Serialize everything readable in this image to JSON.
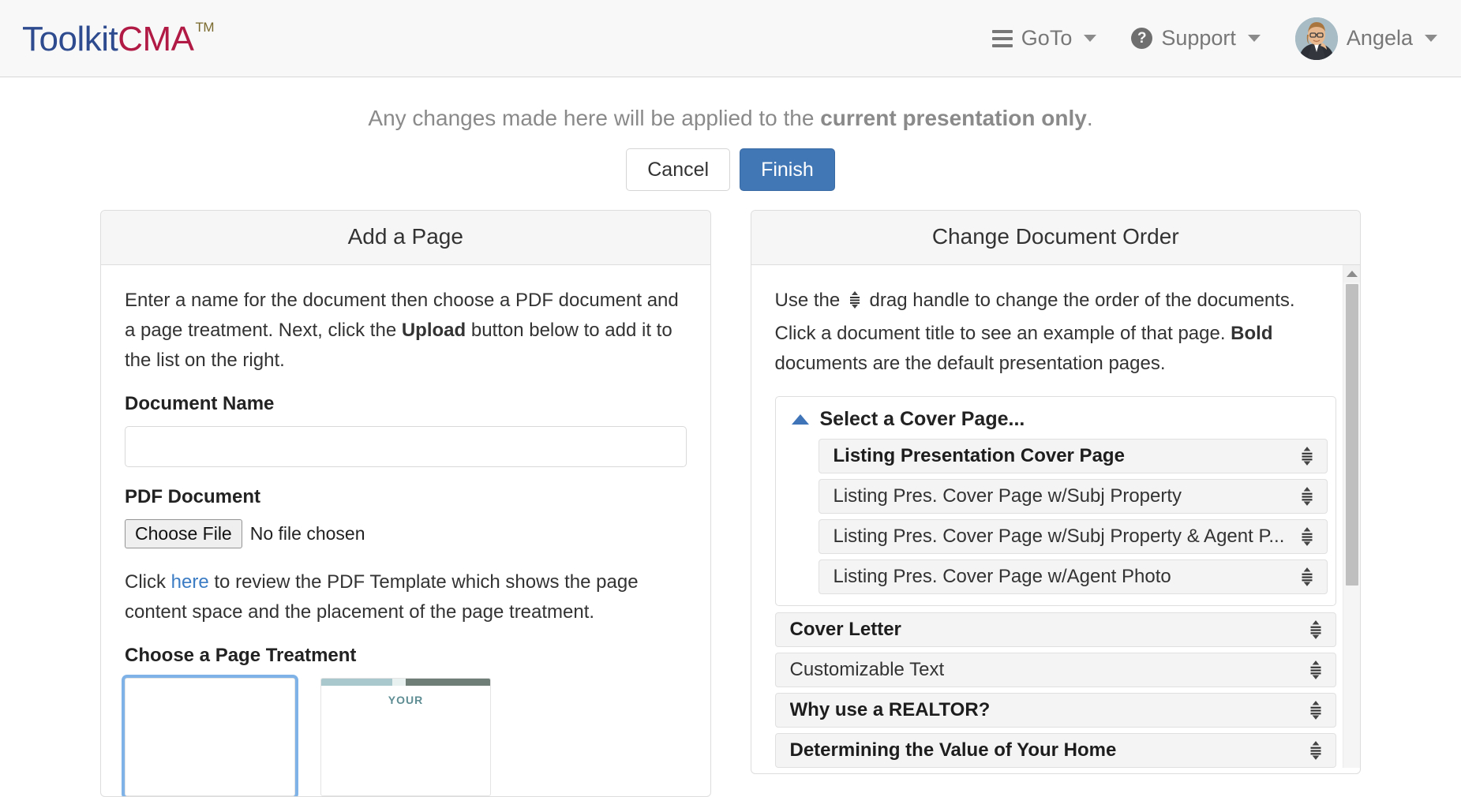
{
  "brand": {
    "part1": "Toolkit",
    "part2": "CMA",
    "tm": "TM"
  },
  "nav": {
    "goto": {
      "label": "GoTo",
      "icon": "hamburger-icon"
    },
    "support": {
      "label": "Support",
      "icon": "question-circle-icon"
    },
    "user": {
      "label": "Angela",
      "icon": "avatar"
    }
  },
  "notice": {
    "text_before": "Any changes made here will be applied to the ",
    "text_bold": "current presentation only",
    "text_after": "."
  },
  "actions": {
    "cancel": "Cancel",
    "finish": "Finish"
  },
  "left_panel": {
    "title": "Add a Page",
    "intro_1": "Enter a name for the document then choose a PDF document and a page treatment. Next, click the ",
    "intro_bold": "Upload",
    "intro_2": " button below to add it to the list on the right.",
    "document_name_label": "Document Name",
    "document_name_value": "",
    "document_name_placeholder": "",
    "pdf_document_label": "PDF Document",
    "choose_file_button": "Choose File",
    "file_status": "No file chosen",
    "template_text_1": "Click ",
    "template_link": "here",
    "template_text_2": " to review the PDF Template which shows the page content space and the placement of the page treatment.",
    "page_treatment_label": "Choose a Page Treatment",
    "treatments": [
      {
        "name": "plain-page-treatment",
        "selected": true,
        "caption": ""
      },
      {
        "name": "branded-page-treatment",
        "selected": false,
        "caption": "YOUR"
      }
    ]
  },
  "right_panel": {
    "title": "Change Document Order",
    "intro_1": "Use the ",
    "intro_2": " drag handle to change the order of the documents. Click a document title to see an example of that page. ",
    "intro_bold": "Bold",
    "intro_3": " documents are the default presentation pages.",
    "cover_group_label": "Select a Cover Page...",
    "cover_items": [
      {
        "label": "Listing Presentation Cover Page",
        "bold": true
      },
      {
        "label": "Listing Pres. Cover Page w/Subj Property",
        "bold": false
      },
      {
        "label": "Listing Pres. Cover Page w/Subj Property & Agent P...",
        "bold": false
      },
      {
        "label": "Listing Pres. Cover Page w/Agent Photo",
        "bold": false
      }
    ],
    "documents": [
      {
        "label": "Cover Letter",
        "bold": true
      },
      {
        "label": "Customizable Text",
        "bold": false
      },
      {
        "label": "Why use a REALTOR?",
        "bold": true
      },
      {
        "label": "Determining the Value of Your Home",
        "bold": true
      }
    ]
  },
  "colors": {
    "brand_blue": "#2e4b8f",
    "brand_red": "#b01a44",
    "primary_button": "#4277b5",
    "link": "#3b7cc4",
    "chevron": "#3f74b8"
  }
}
